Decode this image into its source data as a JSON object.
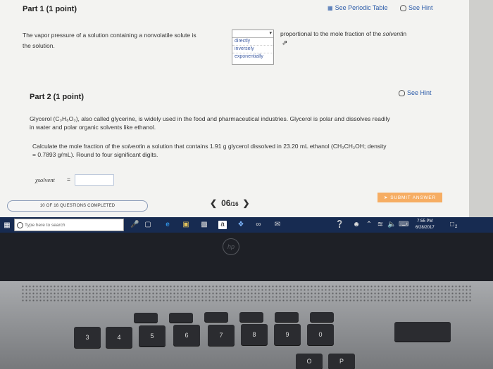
{
  "header": {
    "see_periodic_table": "See Periodic Table",
    "see_hint": "See Hint"
  },
  "part1": {
    "title": "Part 1  (1 point)",
    "sentence_before": "The vapor pressure of a solution containing a nonvolatile solute is",
    "sentence_after_pre": "proportional to the mole fraction of the ",
    "sentence_after_em": "solvent",
    "sentence_after_post": "in",
    "sentence_line2": "the solution.",
    "dropdown": {
      "selected": "",
      "options": [
        "directly",
        "inversely",
        "exponentially"
      ]
    }
  },
  "part2": {
    "title": "Part 2  (1 point)",
    "see_hint": "See Hint",
    "intro_line1": "Glycerol (C₃H₈O₃), also called glycerine, is widely used in the food and pharmaceutical industries. Glycerol is polar and dissolves readily",
    "intro_line2": "in water and polar organic solvents like ethanol.",
    "question_line1_pre": "Calculate the mole fraction of the ",
    "question_line1_em": "solvent",
    "question_line1_post": "in a solution that contains 1.91 g glycerol dissolved in 23.20 mL ethanol (CH₃CH₂OH; density",
    "question_line2": "= 0.7893 g/mL). Round to four significant digits.",
    "answer_label": "χsolvent",
    "answer_eq": "=",
    "answer_value": ""
  },
  "footer": {
    "progress_text": "10 OF 16 QUESTIONS COMPLETED",
    "progress_fraction": 0.625,
    "page_current": "06",
    "page_total": "/16",
    "submit_label": "SUBMIT ANSWER"
  },
  "taskbar": {
    "search_placeholder": "Type here to search",
    "time": "7:55 PM",
    "date": "6/28/2017",
    "notification_count": "2"
  },
  "laptop": {
    "logo": "hp",
    "number_keys": [
      "3",
      "4",
      "5",
      "6",
      "7",
      "8",
      "9",
      "0"
    ],
    "shift_symbols": [
      "#",
      "$",
      "%",
      "^",
      "&",
      "*",
      "(",
      ")"
    ],
    "letter_keys": [
      "P",
      "O"
    ]
  },
  "colors": {
    "link": "#2a5aa8",
    "submit": "#f6ad63",
    "taskbar": "#172b51"
  }
}
